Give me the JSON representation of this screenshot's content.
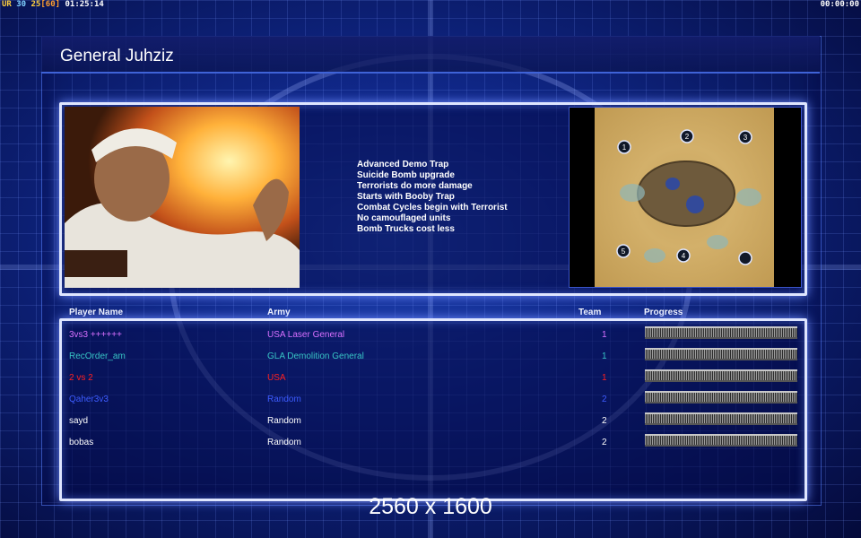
{
  "topbar": {
    "ur_label": "UR",
    "fps_a": "30",
    "fps_b": "25",
    "fps_c": "[60]",
    "clock": "01:25:14",
    "timer": "00:00:00"
  },
  "general": {
    "title": "General Juhziz"
  },
  "rules": [
    "Advanced Demo Trap",
    "Suicide Bomb upgrade",
    "Terrorists do more damage",
    "Starts with Booby Trap",
    "Combat Cycles begin with Terrorist",
    "No camouflaged units",
    "Bomb Trucks cost less"
  ],
  "map": {
    "start_markers": [
      "1",
      "2",
      "3",
      "4",
      "5",
      ""
    ]
  },
  "table": {
    "headers": {
      "name": "Player Name",
      "army": "Army",
      "team": "Team",
      "progress": "Progress"
    },
    "rows": [
      {
        "name": "3vs3 ++++++",
        "army": "USA Laser General",
        "team": "1",
        "color": "#d870ff"
      },
      {
        "name": "RecOrder_am",
        "army": "GLA Demolition General",
        "team": "1",
        "color": "#38c6c6"
      },
      {
        "name": "2 vs 2",
        "army": "USA",
        "team": "1",
        "color": "#ff2020"
      },
      {
        "name": "Qaher3v3",
        "army": "Random",
        "team": "2",
        "color": "#3d5cff"
      },
      {
        "name": "sayd",
        "army": "Random",
        "team": "2",
        "color": "#ffffff"
      },
      {
        "name": "bobas",
        "army": "Random",
        "team": "2",
        "color": "#ffffff"
      }
    ]
  },
  "resolution": "2560 x 1600",
  "colors": {
    "panel_border": "#dfe6ff",
    "title_bar_border": "#3f63d8",
    "background": "#10288a"
  }
}
